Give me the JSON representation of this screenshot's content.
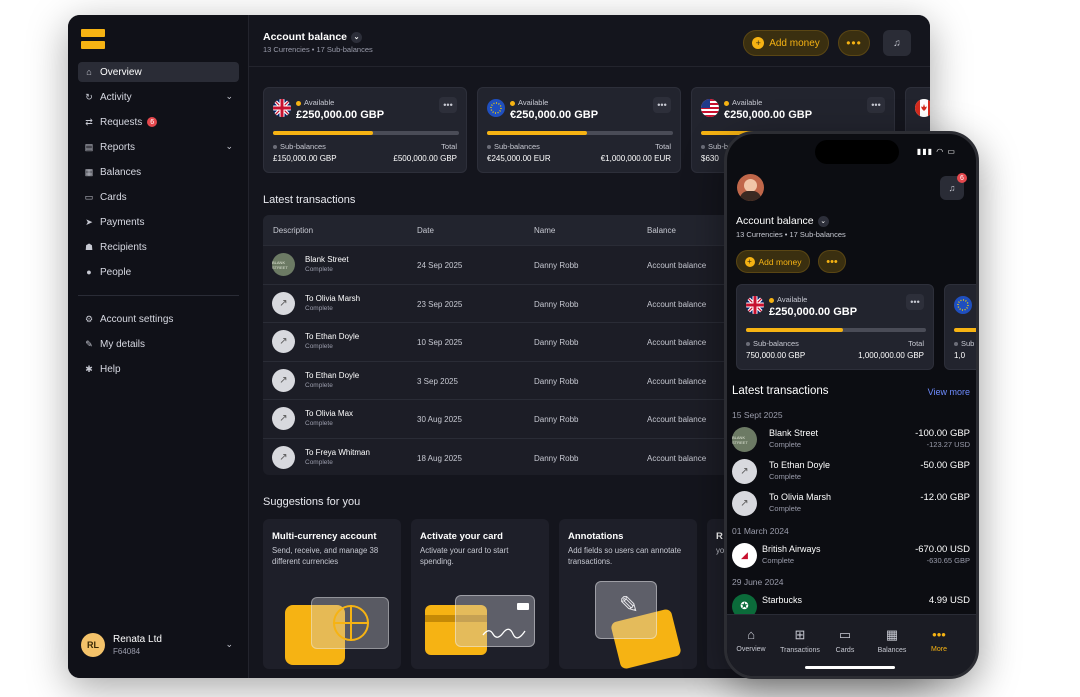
{
  "sidebar": {
    "nav": [
      {
        "label": "Overview",
        "icon": "home-icon"
      },
      {
        "label": "Activity",
        "icon": "activity-icon",
        "expandable": true
      },
      {
        "label": "Requests",
        "icon": "request-icon",
        "badge": "6"
      },
      {
        "label": "Reports",
        "icon": "reports-icon",
        "expandable": true
      },
      {
        "label": "Balances",
        "icon": "balances-icon"
      },
      {
        "label": "Cards",
        "icon": "card-icon"
      },
      {
        "label": "Payments",
        "icon": "payments-icon"
      },
      {
        "label": "Recipients",
        "icon": "recipients-icon"
      },
      {
        "label": "People",
        "icon": "people-icon"
      }
    ],
    "secondary": [
      {
        "label": "Account settings",
        "icon": "settings-icon"
      },
      {
        "label": "My details",
        "icon": "pin-icon"
      },
      {
        "label": "Help",
        "icon": "help-icon"
      }
    ],
    "user": {
      "initials": "RL",
      "name": "Renata Ltd",
      "id": "F64084"
    }
  },
  "header": {
    "title": "Account balance",
    "subtitle": "13 Currencies • 17 Sub-balances",
    "add_money": "Add money",
    "more": "•••"
  },
  "balances": [
    {
      "flag": "uk-flag-icon",
      "available_label": "Available",
      "amount": "£250,000.00 GBP",
      "progress": 0.54,
      "sub_label": "Sub-balances",
      "total_label": "Total",
      "sub_value": "£150,000.00 GBP",
      "total_value": "£500,000.00 GBP"
    },
    {
      "flag": "eu-flag-icon",
      "available_label": "Available",
      "amount": "€250,000.00 GBP",
      "progress": 0.54,
      "sub_label": "Sub-balances",
      "total_label": "Total",
      "sub_value": "€245,000.00 EUR",
      "total_value": "€1,000,000.00 EUR"
    },
    {
      "flag": "us-flag-icon",
      "available_label": "Available",
      "amount": "€250,000.00 GBP",
      "progress": 0.54,
      "sub_label": "Sub-balances",
      "total_label": "Total",
      "sub_value": "$630",
      "total_value": ""
    }
  ],
  "transactions": {
    "title": "Latest transactions",
    "columns": [
      "Description",
      "Date",
      "Name",
      "Balance"
    ],
    "rows": [
      {
        "desc": "Blank Street",
        "status": "Complete",
        "date": "24 Sep 2025",
        "name": "Danny Robb",
        "balance": "Account balance",
        "logo": "BLANK STREET"
      },
      {
        "desc": "To Olivia Marsh",
        "status": "Complete",
        "date": "23 Sep 2025",
        "name": "Danny Robb",
        "balance": "Account balance"
      },
      {
        "desc": "To Ethan Doyle",
        "status": "Complete",
        "date": "10 Sep 2025",
        "name": "Danny Robb",
        "balance": "Account balance"
      },
      {
        "desc": "To Ethan Doyle",
        "status": "Complete",
        "date": "3 Sep 2025",
        "name": "Danny Robb",
        "balance": "Account balance"
      },
      {
        "desc": "To Olivia Max",
        "status": "Complete",
        "date": "30 Aug 2025",
        "name": "Danny Robb",
        "balance": "Account balance"
      },
      {
        "desc": "To Freya Whitman",
        "status": "Complete",
        "date": "18 Aug 2025",
        "name": "Danny Robb",
        "balance": "Account balance"
      }
    ]
  },
  "suggestions": {
    "title": "Suggestions for you",
    "items": [
      {
        "title": "Multi-currency account",
        "desc": "Send, receive, and manage 38 different currencies"
      },
      {
        "title": "Activate your card",
        "desc": "Activate your card to start spending."
      },
      {
        "title": "Annotations",
        "desc": "Add fields so users can annotate transactions."
      },
      {
        "title": "R",
        "desc": "yo"
      }
    ]
  },
  "phone": {
    "status_bar": "▮▮▮ ◠ ▭",
    "notif_badge": "6",
    "title": "Account balance",
    "subtitle": "13 Currencies • 17 Sub-balances",
    "add_money": "Add money",
    "card": {
      "available_label": "Available",
      "amount": "£250,000.00 GBP",
      "progress": 0.54,
      "sub_label": "Sub-balances",
      "total_label": "Total",
      "sub_value": "750,000.00 GBP",
      "total_value": "1,000,000.00 GBP"
    },
    "card2_sub": "Sub",
    "card2_value": "1,0",
    "latest_title": "Latest transactions",
    "view_more": "View more",
    "groups": [
      {
        "date": "15 Sept 2025",
        "items": [
          {
            "name": "Blank Street",
            "status": "Complete",
            "amount": "-100.00 GBP",
            "sub_amount": "-123.27 USD",
            "logo": "BLANK STREET"
          },
          {
            "name": "To Ethan Doyle",
            "status": "Complete",
            "amount": "-50.00 GBP",
            "sub_amount": ""
          },
          {
            "name": "To Olivia Marsh",
            "status": "Complete",
            "amount": "-12.00 GBP",
            "sub_amount": ""
          }
        ]
      },
      {
        "date": "01 March 2024",
        "items": [
          {
            "name": "British Airways",
            "status": "Complete",
            "amount": "-670.00 USD",
            "sub_amount": "-630.65 GBP"
          }
        ]
      },
      {
        "date": "29 June 2024",
        "items": [
          {
            "name": "Starbucks",
            "status": "",
            "amount": "4.99 USD",
            "sub_amount": ""
          }
        ]
      }
    ],
    "tabs": [
      "Overview",
      "Transactions",
      "Cards",
      "Balances",
      "More"
    ]
  },
  "colors": {
    "accent": "#f6b313",
    "bg": "#101118",
    "panel": "#22242e",
    "link": "#6e8cff",
    "alert": "#e5484d"
  }
}
